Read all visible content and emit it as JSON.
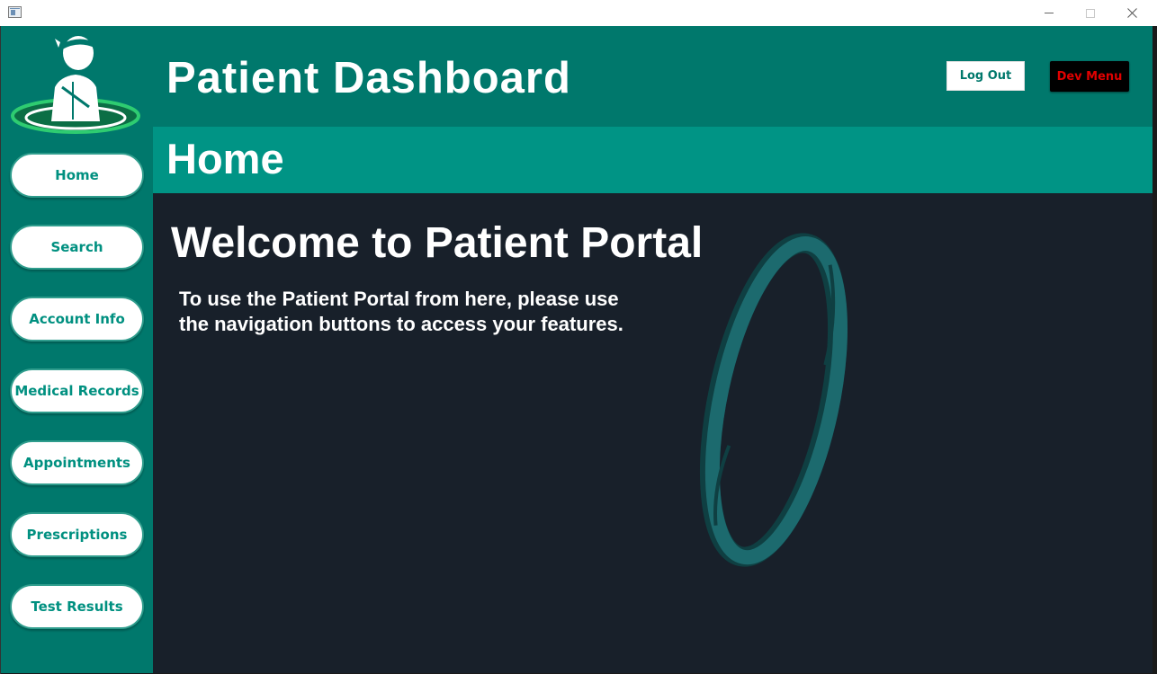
{
  "window": {
    "minimize_icon": "minimize-icon",
    "maximize_icon": "maximize-icon",
    "close_icon": "close-icon"
  },
  "header": {
    "title": "Patient Dashboard",
    "logout_label": "Log Out",
    "devmenu_label": "Dev Menu"
  },
  "section": {
    "title": "Home"
  },
  "sidebar": {
    "items": [
      {
        "label": "Home"
      },
      {
        "label": "Search"
      },
      {
        "label": "Account Info"
      },
      {
        "label": "Medical Records"
      },
      {
        "label": "Appointments"
      },
      {
        "label": "Prescriptions"
      },
      {
        "label": "Test Results"
      }
    ]
  },
  "main": {
    "welcome": "Welcome to Patient Portal",
    "instructions": "To use the Patient Portal from here, please use the navigation buttons to access your features."
  },
  "colors": {
    "primary": "#00786c",
    "section": "#009485",
    "background": "#18202a",
    "button_text": "#009080",
    "dev_menu_text": "#e00000"
  }
}
